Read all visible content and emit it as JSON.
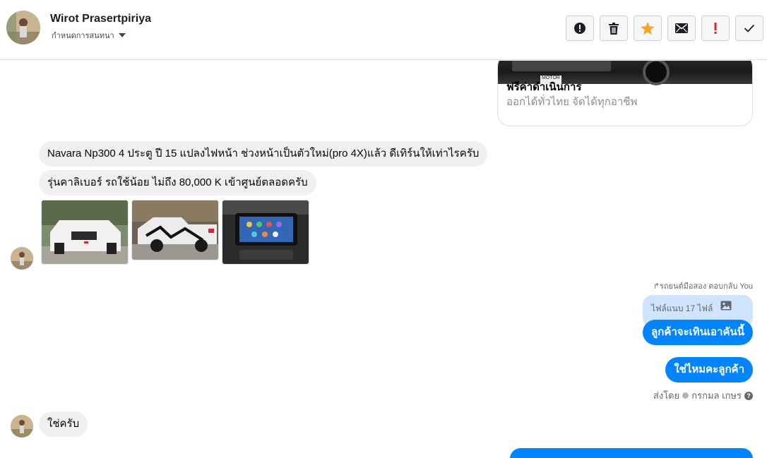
{
  "header": {
    "contact_name": "Wirot Prasertpiriya",
    "assign_label": "กำหนดการสนทนา",
    "actions": [
      {
        "icon": "alert-icon",
        "color": "#1c1e21"
      },
      {
        "icon": "trash-icon",
        "color": "#1c1e21"
      },
      {
        "icon": "star-icon",
        "color": "#f5a623"
      },
      {
        "icon": "mail-icon",
        "color": "#1c1e21"
      },
      {
        "icon": "exclamation-icon",
        "color": "#e02424"
      },
      {
        "icon": "check-icon",
        "color": "#1c1e21"
      }
    ]
  },
  "link_card": {
    "plate_text": "MOTOR",
    "title": "ฟรีค่าดำเนินการ",
    "description": "ออกได้ทั่วไทย จัดได้ทุกอาชีพ"
  },
  "messages": {
    "in_1": "Navara Np300 4 ประตู  ปี 15 แปลงไฟหน้า ช่วงหน้าเป็นตัวใหม่(pro 4X)แล้ว  ดีเทิร์นให้เท่าไรครับ",
    "in_2": "รุ่นคาลิเบอร์ รถใช้น้อย ไม่ถึง 80,000 K  เข้าศูนย์ตลอดครับ",
    "reply_note": "รถยนต์มือสอง ตอบกลับ You",
    "reply_quote": "ไฟล์แนบ 17 ไฟล์",
    "out_1": "ลูกค้าจะเทินเอาคันนี้",
    "out_2": "ใช่ไหมคะลูกค้า",
    "sent_by_label": "ส่งโดย",
    "sent_by_name": "กรกมล เกษร",
    "in_3": "ใช่ครับ"
  },
  "colors": {
    "accent": "#0084ff",
    "incoming_bubble": "#f0f0f0",
    "reply_quote_bg": "#cfe4ff"
  }
}
